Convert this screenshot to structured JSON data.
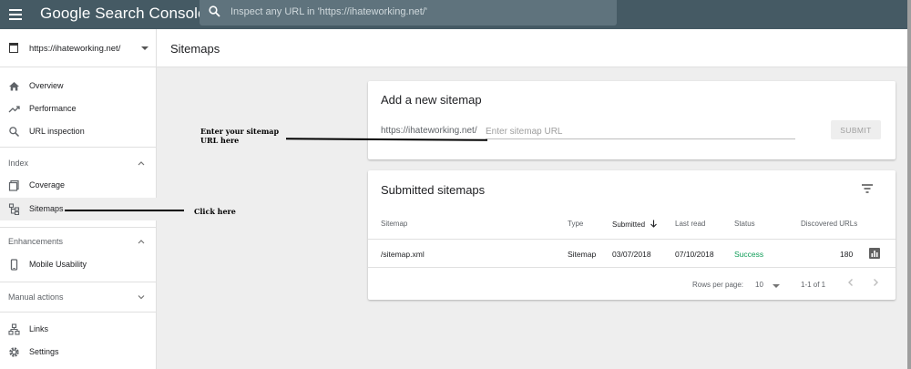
{
  "topbar": {
    "brand": "Google Search Console",
    "search_placeholder": "Inspect any URL in 'https://ihateworking.net/'"
  },
  "sidebar": {
    "property": "https://ihateworking.net/",
    "items": [
      {
        "label": "Overview",
        "icon": "home-icon"
      },
      {
        "label": "Performance",
        "icon": "trending-up-icon"
      },
      {
        "label": "URL inspection",
        "icon": "search-icon"
      }
    ],
    "index_section": {
      "label": "Index",
      "items": [
        {
          "label": "Coverage",
          "icon": "coverage-icon"
        },
        {
          "label": "Sitemaps",
          "icon": "sitemap-icon",
          "active": true
        }
      ]
    },
    "enhancements_section": {
      "label": "Enhancements",
      "items": [
        {
          "label": "Mobile Usability",
          "icon": "phone-icon"
        }
      ]
    },
    "manual_actions_section": {
      "label": "Manual actions"
    },
    "bottom_items": [
      {
        "label": "Links",
        "icon": "links-icon"
      },
      {
        "label": "Settings",
        "icon": "gear-icon"
      }
    ]
  },
  "page": {
    "title": "Sitemaps"
  },
  "add_sitemap": {
    "title": "Add a new sitemap",
    "url_prefix": "https://ihateworking.net/",
    "input_placeholder": "Enter sitemap URL",
    "submit_label": "SUBMIT"
  },
  "submitted": {
    "title": "Submitted sitemaps",
    "columns": [
      "Sitemap",
      "Type",
      "Submitted",
      "Last read",
      "Status",
      "Discovered URLs"
    ],
    "rows": [
      {
        "sitemap": "/sitemap.xml",
        "type": "Sitemap",
        "submitted": "03/07/2018",
        "last_read": "07/10/2018",
        "status": "Success",
        "discovered": "180"
      }
    ],
    "pager": {
      "rows_label": "Rows per page:",
      "rows_value": "10",
      "range": "1-1 of 1"
    }
  },
  "annotations": {
    "enter_url": [
      "Enter your sitemap",
      "URL here"
    ],
    "click_here": "Click here"
  },
  "colors": {
    "topbar": "#455a64",
    "success": "#0f9d58",
    "background": "#eeeeee"
  }
}
